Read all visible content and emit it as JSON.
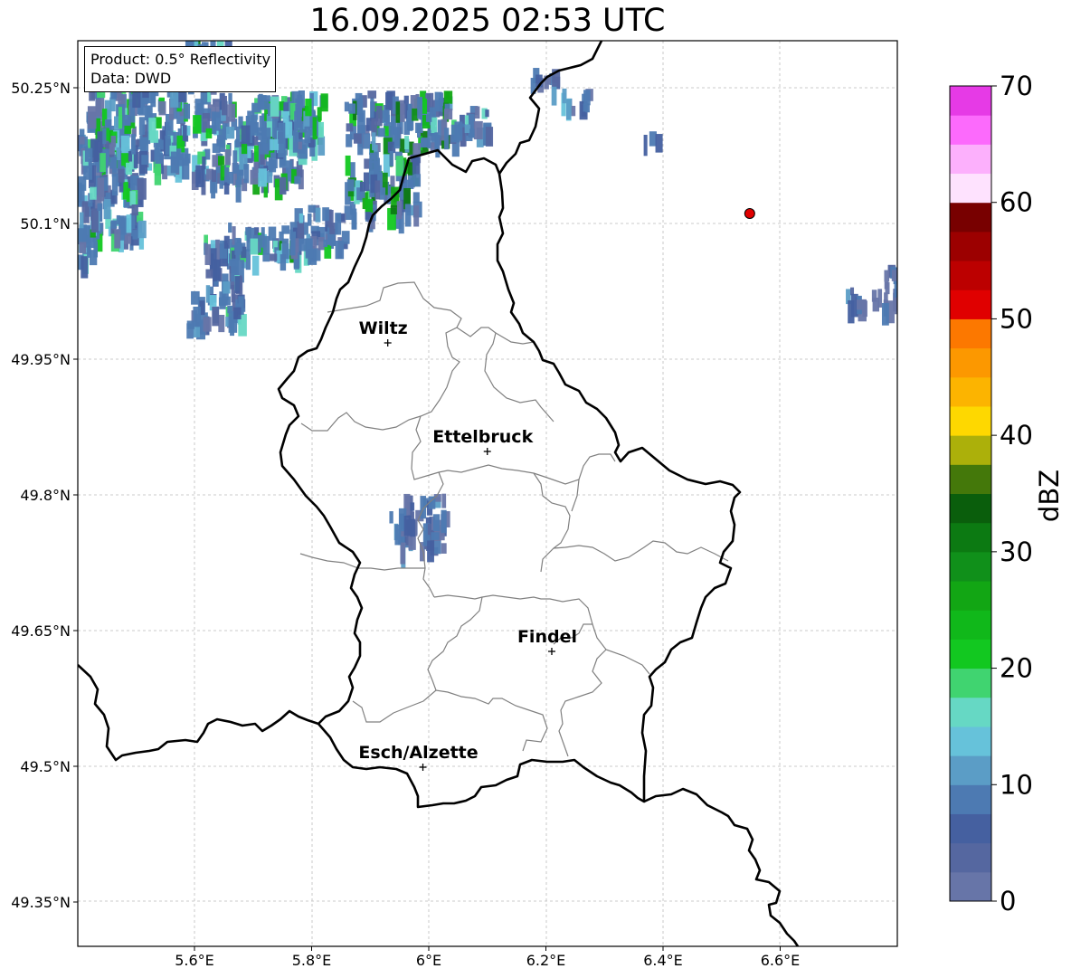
{
  "title": "16.09.2025 02:53 UTC",
  "info_box": {
    "product": "Product: 0.5° Reflectivity",
    "data": "Data: DWD"
  },
  "map": {
    "lon_range": [
      5.4,
      6.8
    ],
    "lat_range": [
      49.3,
      50.3
    ],
    "grid": true,
    "lon_ticks": [
      {
        "value": 5.6,
        "label": "5.6°E"
      },
      {
        "value": 5.8,
        "label": "5.8°E"
      },
      {
        "value": 6.0,
        "label": "6°E"
      },
      {
        "value": 6.2,
        "label": "6.2°E"
      },
      {
        "value": 6.4,
        "label": "6.4°E"
      },
      {
        "value": 6.6,
        "label": "6.6°E"
      }
    ],
    "lat_ticks": [
      {
        "value": 50.25,
        "label": "50.25°N"
      },
      {
        "value": 50.1,
        "label": "50.1°N"
      },
      {
        "value": 49.95,
        "label": "49.95°N"
      },
      {
        "value": 49.8,
        "label": "49.8°N"
      },
      {
        "value": 49.65,
        "label": "49.65°N"
      },
      {
        "value": 49.5,
        "label": "49.5°N"
      },
      {
        "value": 49.35,
        "label": "49.35°N"
      }
    ],
    "cities": [
      {
        "name": "Wiltz",
        "lon": 5.93,
        "lat": 49.968
      },
      {
        "name": "Ettelbruck",
        "lon": 6.1,
        "lat": 49.848
      },
      {
        "name": "Findel",
        "lon": 6.21,
        "lat": 49.627
      },
      {
        "name": "Esch/Alzette",
        "lon": 5.99,
        "lat": 49.499
      }
    ],
    "radar_site": {
      "lon": 6.548,
      "lat": 50.111,
      "color": "#e00000"
    }
  },
  "colorbar": {
    "label": "dBZ",
    "min": 0,
    "max": 70,
    "ticks": [
      "0",
      "10",
      "20",
      "30",
      "40",
      "50",
      "60",
      "70"
    ],
    "colors": [
      "#6775a8",
      "#5567a0",
      "#4560a0",
      "#4d7ab2",
      "#5b9dc6",
      "#66c2da",
      "#66d8c4",
      "#40d470",
      "#12c820",
      "#10b81a",
      "#12a614",
      "#10901a",
      "#0c7a12",
      "#0a5e0c",
      "#44780a",
      "#acb00a",
      "#fed800",
      "#fcb400",
      "#fc9800",
      "#fc7800",
      "#e00000",
      "#bc0000",
      "#9c0000",
      "#780000",
      "#fee2fe",
      "#fcb0fc",
      "#fc6afc",
      "#e63ae6"
    ]
  }
}
